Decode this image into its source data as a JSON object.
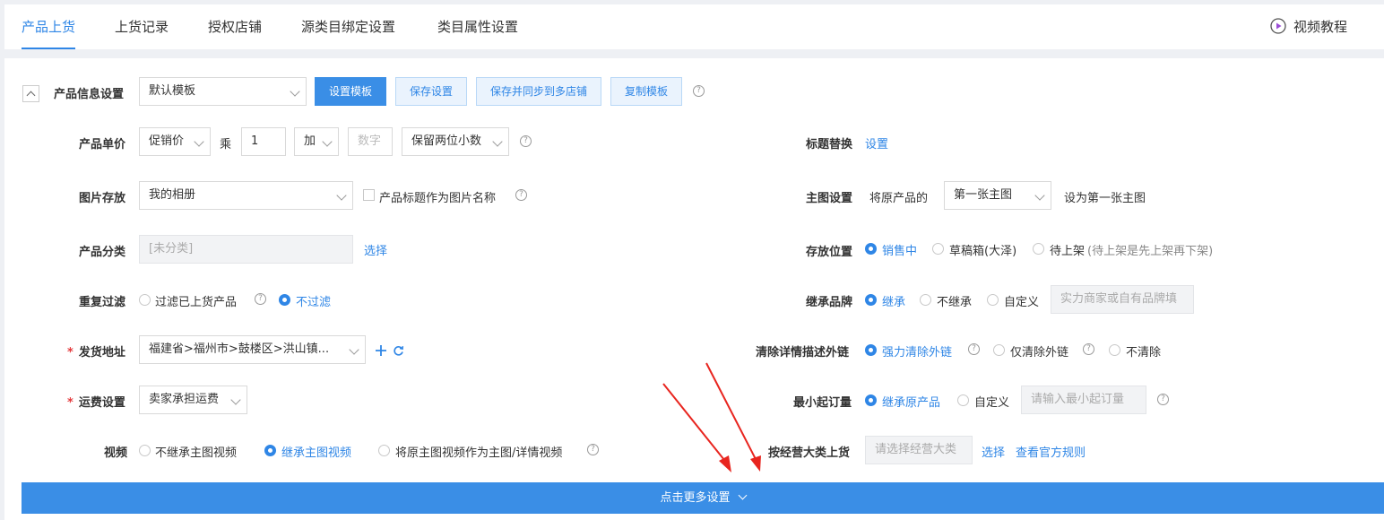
{
  "tabs": [
    {
      "label": "产品上货"
    },
    {
      "label": "上货记录"
    },
    {
      "label": "授权店铺"
    },
    {
      "label": "源类目绑定设置"
    },
    {
      "label": "类目属性设置"
    }
  ],
  "video_tutorial": "视频教程",
  "template": {
    "label": "产品信息设置",
    "selected": "默认模板",
    "buttons": {
      "set": "设置模板",
      "save": "保存设置",
      "save_sync": "保存并同步到多店铺",
      "copy": "复制模板"
    }
  },
  "left": {
    "price": {
      "label": "产品单价",
      "base": "促销价",
      "times": "乘",
      "multiplier": "1",
      "op": "加",
      "number_placeholder": "数字",
      "rounding": "保留两位小数"
    },
    "image_storage": {
      "label": "图片存放",
      "album": "我的相册",
      "title_as_name": "产品标题作为图片名称"
    },
    "category": {
      "label": "产品分类",
      "value": "[未分类]",
      "choose": "选择"
    },
    "dedupe": {
      "label": "重复过滤",
      "options": [
        "过滤已上货产品",
        "不过滤"
      ],
      "selected": 1
    },
    "ship_from": {
      "label": "发货地址",
      "required_mark": "*",
      "value": "福建省>福州市>鼓楼区>洪山镇..."
    },
    "freight": {
      "label": "运费设置",
      "required_mark": "*",
      "value": "卖家承担运费"
    },
    "video": {
      "label": "视频",
      "options": [
        "不继承主图视频",
        "继承主图视频",
        "将原主图视频作为主图/详情视频"
      ],
      "selected": 1
    }
  },
  "right": {
    "title_replace": {
      "label": "标题替换",
      "link": "设置"
    },
    "main_image": {
      "label": "主图设置",
      "prefix": "将原产品的",
      "choice": "第一张主图",
      "suffix": "设为第一张主图"
    },
    "storage_location": {
      "label": "存放位置",
      "options": [
        "销售中",
        "草稿箱(大泽)",
        "待上架"
      ],
      "note": "(待上架是先上架再下架)",
      "selected": 0
    },
    "brand": {
      "label": "继承品牌",
      "options": [
        "继承",
        "不继承",
        "自定义"
      ],
      "selected": 0,
      "placeholder": "实力商家或自有品牌填"
    },
    "clean_links": {
      "label": "清除详情描述外链",
      "options": [
        "强力清除外链",
        "仅清除外链",
        "不清除"
      ],
      "selected": 0
    },
    "min_order": {
      "label": "最小起订量",
      "options": [
        "继承原产品",
        "自定义"
      ],
      "selected": 0,
      "placeholder": "请输入最小起订量"
    },
    "by_category": {
      "label": "按经营大类上货",
      "placeholder": "请选择经营大类",
      "choose": "选择",
      "rules": "查看官方规则"
    }
  },
  "more_settings": "点击更多设置",
  "colors": {
    "accent": "#2f86e6",
    "button_primary": "#3a8ee6",
    "required": "#e4393c",
    "annotation_arrow": "#e8251f"
  }
}
